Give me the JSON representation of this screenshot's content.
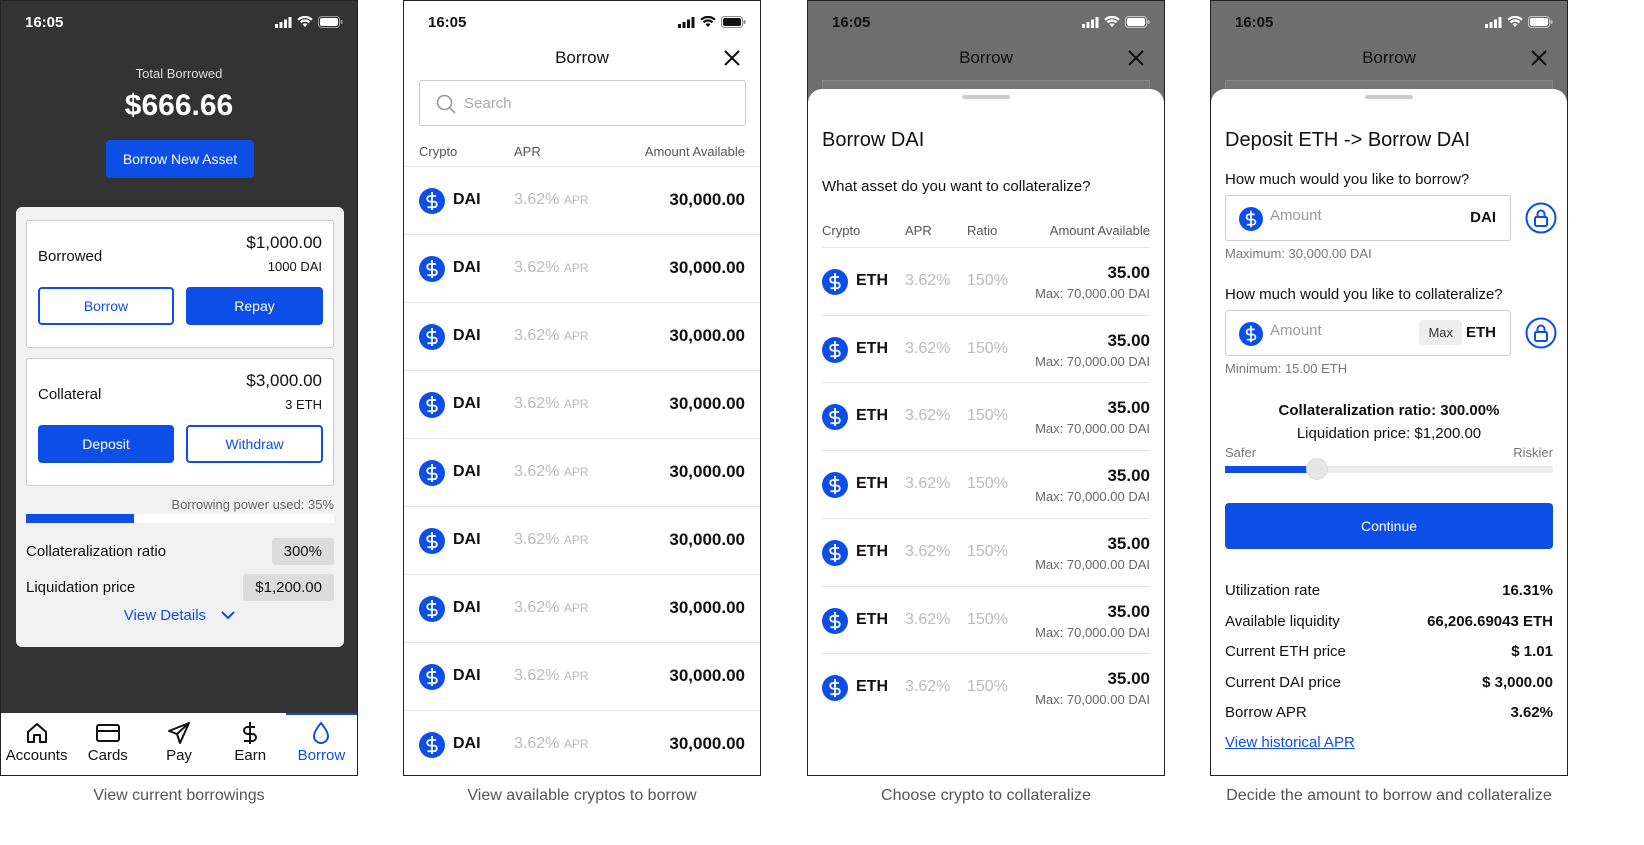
{
  "status": {
    "time": "16:05"
  },
  "screen1": {
    "total_label": "Total Borrowed",
    "total_amount": "$666.66",
    "borrow_new": "Borrow New Asset",
    "borrowed": {
      "title": "Borrowed",
      "amount": "$1,000.00",
      "sub": "1000 DAI",
      "btn1": "Borrow",
      "btn2": "Repay"
    },
    "collateral": {
      "title": "Collateral",
      "amount": "$3,000.00",
      "sub": "3 ETH",
      "btn1": "Deposit",
      "btn2": "Withdraw"
    },
    "power_label": "Borrowing power used: 35%",
    "power_fraction": 0.35,
    "ratio_label": "Collateralization ratio",
    "ratio_value": "300%",
    "liq_label": "Liquidation price",
    "liq_value": "$1,200.00",
    "view_details": "View Details",
    "tabs": [
      {
        "label": "Accounts",
        "icon": "home-icon"
      },
      {
        "label": "Cards",
        "icon": "card-icon"
      },
      {
        "label": "Pay",
        "icon": "send-icon"
      },
      {
        "label": "Earn",
        "icon": "dollar-icon"
      },
      {
        "label": "Borrow",
        "icon": "drop-icon"
      }
    ],
    "active_tab": 4,
    "caption": "View current borrowings"
  },
  "screen2": {
    "title": "Borrow",
    "search_placeholder": "Search",
    "headers": {
      "crypto": "Crypto",
      "apr": "APR",
      "amount": "Amount Available"
    },
    "rows": [
      {
        "ticker": "DAI",
        "apr": "3.62%",
        "apr_unit": "APR",
        "amount": "30,000.00"
      },
      {
        "ticker": "DAI",
        "apr": "3.62%",
        "apr_unit": "APR",
        "amount": "30,000.00"
      },
      {
        "ticker": "DAI",
        "apr": "3.62%",
        "apr_unit": "APR",
        "amount": "30,000.00"
      },
      {
        "ticker": "DAI",
        "apr": "3.62%",
        "apr_unit": "APR",
        "amount": "30,000.00"
      },
      {
        "ticker": "DAI",
        "apr": "3.62%",
        "apr_unit": "APR",
        "amount": "30,000.00"
      },
      {
        "ticker": "DAI",
        "apr": "3.62%",
        "apr_unit": "APR",
        "amount": "30,000.00"
      },
      {
        "ticker": "DAI",
        "apr": "3.62%",
        "apr_unit": "APR",
        "amount": "30,000.00"
      },
      {
        "ticker": "DAI",
        "apr": "3.62%",
        "apr_unit": "APR",
        "amount": "30,000.00"
      },
      {
        "ticker": "DAI",
        "apr": "3.62%",
        "apr_unit": "APR",
        "amount": "30,000.00"
      }
    ],
    "caption": "View available cryptos to borrow"
  },
  "screen3": {
    "bg_title": "Borrow",
    "title": "Borrow DAI",
    "question": "What asset do you want to collateralize?",
    "headers": {
      "crypto": "Crypto",
      "apr": "APR",
      "ratio": "Ratio",
      "amount": "Amount Available"
    },
    "rows": [
      {
        "ticker": "ETH",
        "apr": "3.62%",
        "ratio": "150%",
        "amount": "35.00",
        "max": "Max: 70,000.00 DAI"
      },
      {
        "ticker": "ETH",
        "apr": "3.62%",
        "ratio": "150%",
        "amount": "35.00",
        "max": "Max: 70,000.00 DAI"
      },
      {
        "ticker": "ETH",
        "apr": "3.62%",
        "ratio": "150%",
        "amount": "35.00",
        "max": "Max: 70,000.00 DAI"
      },
      {
        "ticker": "ETH",
        "apr": "3.62%",
        "ratio": "150%",
        "amount": "35.00",
        "max": "Max: 70,000.00 DAI"
      },
      {
        "ticker": "ETH",
        "apr": "3.62%",
        "ratio": "150%",
        "amount": "35.00",
        "max": "Max: 70,000.00 DAI"
      },
      {
        "ticker": "ETH",
        "apr": "3.62%",
        "ratio": "150%",
        "amount": "35.00",
        "max": "Max: 70,000.00 DAI"
      },
      {
        "ticker": "ETH",
        "apr": "3.62%",
        "ratio": "150%",
        "amount": "35.00",
        "max": "Max: 70,000.00 DAI"
      }
    ],
    "caption": "Choose crypto to collateralize"
  },
  "screen4": {
    "bg_title": "Borrow",
    "title": "Deposit ETH -> Borrow DAI",
    "q_borrow": "How much would you like to borrow?",
    "borrow_placeholder": "Amount",
    "borrow_unit": "DAI",
    "borrow_hint": "Maximum: 30,000.00 DAI",
    "q_collat": "How much would you like to collateralize?",
    "collat_placeholder": "Amount",
    "collat_max": "Max",
    "collat_unit": "ETH",
    "collat_hint": "Minimum: 15.00 ETH",
    "ratio_text": "Collateralization ratio: 300.00%",
    "liq_text": "Liquidation price: $1,200.00",
    "slider_left": "Safer",
    "slider_right": "Riskier",
    "slider_fraction": 0.28,
    "continue": "Continue",
    "stats": [
      {
        "label": "Utilization rate",
        "value": "16.31%"
      },
      {
        "label": "Available liquidity",
        "value": "66,206.69043 ETH"
      },
      {
        "label": "Current ETH price",
        "value": "$ 1.01"
      },
      {
        "label": "Current DAI price",
        "value": "$ 3,000.00"
      },
      {
        "label": "Borrow APR",
        "value": "3.62%"
      }
    ],
    "link": "View historical APR",
    "caption": "Decide the amount to borrow and collateralize"
  },
  "colors": {
    "accent": "#0d4fe6",
    "dark_bg": "#333333",
    "overlay": "#6e6e6e"
  }
}
